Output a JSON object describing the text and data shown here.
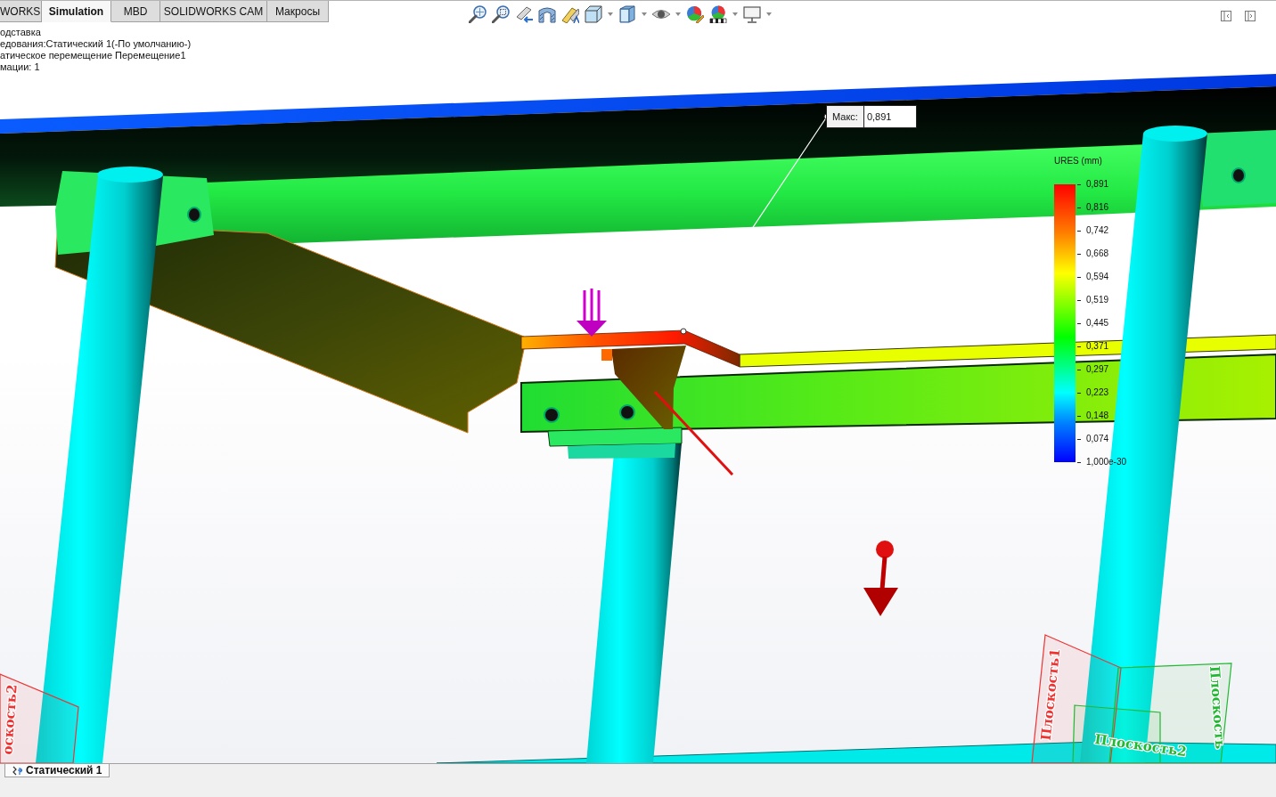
{
  "command_tabs": [
    {
      "label": "WORKS",
      "selected": false
    },
    {
      "label": "Simulation",
      "selected": true
    },
    {
      "label": "MBD",
      "selected": false
    },
    {
      "label": "SOLIDWORKS CAM",
      "selected": false
    },
    {
      "label": "Макросы",
      "selected": false
    }
  ],
  "study_info": [
    "одставка",
    "едования:Статический 1(-По умолчанию-)",
    "атическое перемещение Перемещение1",
    "мации: 1"
  ],
  "max_annotation": {
    "label": "Макс:",
    "value": "0,891"
  },
  "legend": {
    "title": "URES (mm)",
    "labels": [
      "0,891",
      "0,816",
      "0,742",
      "0,668",
      "0,594",
      "0,519",
      "0,445",
      "0,371",
      "0,297",
      "0,223",
      "0,148",
      "0,074",
      "1,000e-30"
    ]
  },
  "planes": [
    {
      "label": "оскость2",
      "color": "#ee3333"
    },
    {
      "label": "Плоскость1",
      "color": "#ee3333"
    },
    {
      "label": "Плоскость2",
      "color": "#22b833"
    },
    {
      "label": "Плоскость",
      "color": "#22b833"
    }
  ],
  "study_tabs": [
    {
      "label": "Статический 1",
      "selected": true
    }
  ]
}
